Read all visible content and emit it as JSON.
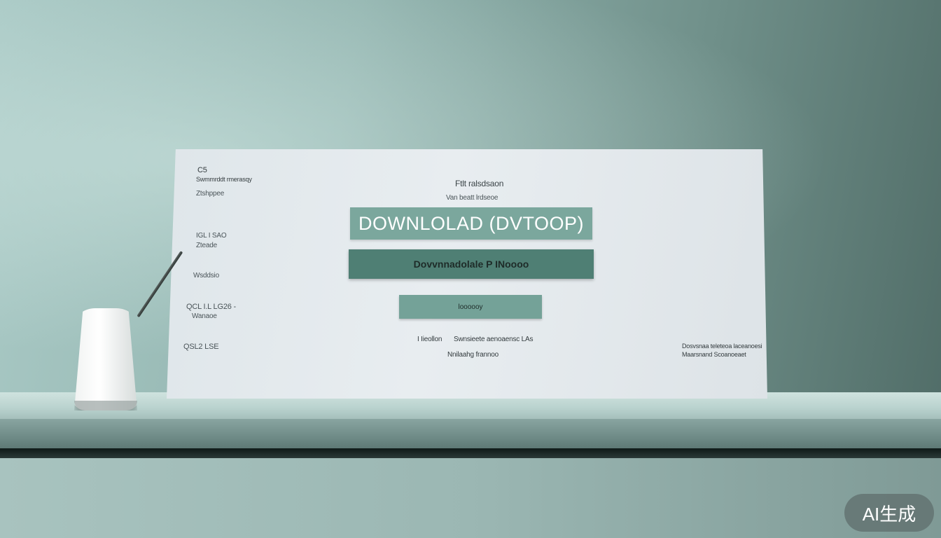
{
  "panel": {
    "left_labels": {
      "l1": "C5",
      "l2": "Swmmrddt rmerasqy",
      "l3": "Ztshppee",
      "l4": "IGL I SAO",
      "l5": "Zteade",
      "l6": "Wsddsio",
      "l7": "QCL I.L LG26 -",
      "l8": "Wanaoe",
      "l9": "QSL2 LSE"
    },
    "header_title": "Ftlt ralsdsaon",
    "header_subtitle": "Van beatt lrdseoe",
    "download_desktop_label": "DOWNLOLAD (DVTOOP)",
    "download_primary_label": "Dovvnnadolale P INoooo",
    "secondary_button_label": "loooooy",
    "footer_center_line1_a": "I Iieollon",
    "footer_center_line1_b": "Swnsieete aenoaensc LAs",
    "footer_center_line2": "Nnilaahg frannoo",
    "footer_right_line1": "Dosvsnaa teleteoa laceanoesi",
    "footer_right_line2": "Maarsnand Scoanoeaet"
  },
  "watermark": {
    "label": "AI生成"
  },
  "colors": {
    "primary_green": "#4f7f74",
    "light_green": "#7ba79d",
    "background": "#93b5b0"
  }
}
